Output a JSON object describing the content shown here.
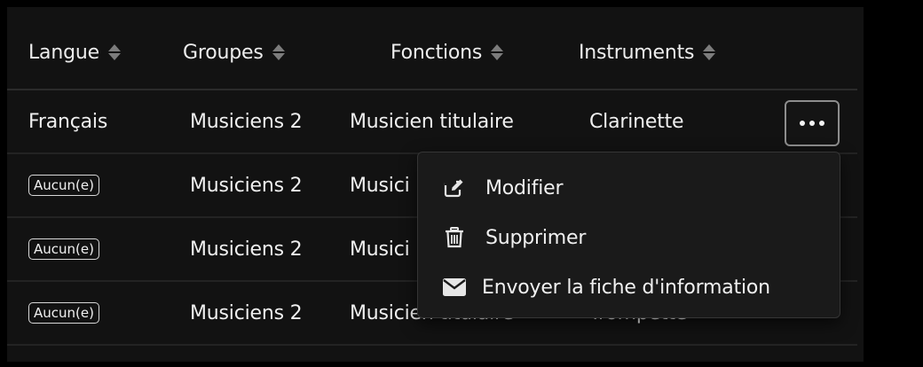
{
  "table": {
    "columns": [
      {
        "label": "Langue",
        "sortable": true
      },
      {
        "label": "Groupes",
        "sortable": true
      },
      {
        "label": "Fonctions",
        "sortable": true
      },
      {
        "label": "Instruments",
        "sortable": true
      }
    ],
    "rows": [
      {
        "langue": "Français",
        "langue_is_badge": false,
        "groupe": "Musiciens 2",
        "fonction": "Musicien titulaire",
        "instrument": "Clarinette"
      },
      {
        "langue": "Aucun(e)",
        "langue_is_badge": true,
        "groupe": "Musiciens 2",
        "fonction": "Musici",
        "instrument": ""
      },
      {
        "langue": "Aucun(e)",
        "langue_is_badge": true,
        "groupe": "Musiciens 2",
        "fonction": "Musici",
        "instrument": ""
      },
      {
        "langue": "Aucun(e)",
        "langue_is_badge": true,
        "groupe": "Musiciens 2",
        "fonction": "Musicien titulaire",
        "instrument": "Trompette"
      }
    ]
  },
  "actions_menu": {
    "button_icon": "ellipsis-icon",
    "items": [
      {
        "label": "Modifier",
        "icon": "edit-icon"
      },
      {
        "label": "Supprimer",
        "icon": "trash-icon"
      },
      {
        "label": "Envoyer la fiche d'information",
        "icon": "envelope-icon"
      }
    ]
  },
  "colors": {
    "background": "#000000",
    "table_bg": "#121212",
    "menu_bg": "#1a1a1a",
    "text": "#e9e9e9",
    "sort_icon": "#7c7c7c"
  }
}
